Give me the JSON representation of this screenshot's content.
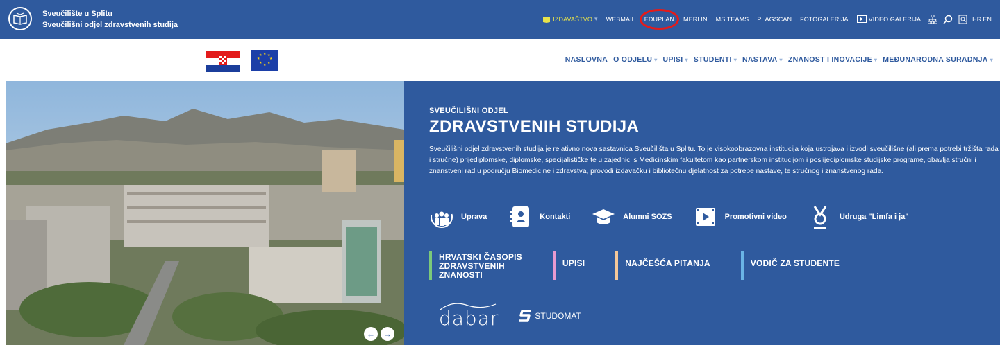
{
  "brand": {
    "line1": "Sveučilište u Splitu",
    "line2": "Sveučilišni odjel zdravstvenih studija"
  },
  "topnav": [
    {
      "label": "IZDAVAŠTVO",
      "caret": "▾"
    },
    {
      "label": "WEBMAIL"
    },
    {
      "label": "EDUPLAN"
    },
    {
      "label": "MERLIN"
    },
    {
      "label": "MS TEAMS"
    },
    {
      "label": "PLAGSCAN"
    },
    {
      "label": "FOTOGALERIJA"
    },
    {
      "label": "VIDEO GALERIJA"
    }
  ],
  "languages": {
    "hr": "HR",
    "en": "EN"
  },
  "mainnav": [
    {
      "label": "NASLOVNA"
    },
    {
      "label": "O ODJELU"
    },
    {
      "label": "UPISI"
    },
    {
      "label": "STUDENTI"
    },
    {
      "label": "NASTAVA"
    },
    {
      "label": "ZNANOST I INOVACIJE"
    },
    {
      "label": "MEĐUNARODNA SURADNJA"
    }
  ],
  "hero": {
    "kicker": "SVEUČILIŠNI ODJEL",
    "title": "ZDRAVSTVENIH STUDIJA",
    "description": "Sveučilišni odjel zdravstvenih studija je relativno nova sastavnica Sveučilišta u Splitu. To je visokoobrazovna institucija koja ustrojava i izvodi sveučilišne (ali prema potrebi tržišta rada i stručne) prijediplomske, diplomske, specijalističke te u zajednici s Medicinskim fakultetom kao partnerskom institucijom i poslijediplomske studijske programe, obavlja stručni i znanstveni rad u području Biomedicine i zdravstva, provodi izdavačku i bibliotečnu djelatnost za potrebe nastave, te stručnog i znanstvenog rada."
  },
  "quick_links": [
    {
      "label": "Uprava",
      "icon": "people-icon"
    },
    {
      "label": "Kontakti",
      "icon": "contacts-icon"
    },
    {
      "label": "Alumni SOZS",
      "icon": "graduation-cap-icon"
    },
    {
      "label": "Promotivni video",
      "icon": "film-icon"
    },
    {
      "label": "Udruga \"Limfa i ja\"",
      "icon": "ribbon-icon"
    }
  ],
  "categories": [
    {
      "lines": [
        "HRVATSKI ČASOPIS",
        "ZDRAVSTVENIH",
        "ZNANOSTI"
      ],
      "color": "#7cc97a"
    },
    {
      "lines": [
        "UPISI"
      ],
      "color": "#e89ad0"
    },
    {
      "lines": [
        "NAJČEŠĆA PITANJA"
      ],
      "color": "#f4c79a"
    },
    {
      "lines": [
        "VODIČ ZA STUDENTE"
      ],
      "color": "#6ab4e6"
    }
  ],
  "partners": {
    "dabar": "dabar",
    "studomat": "STUDOMAT"
  },
  "colors": {
    "primary": "#2f5a9e",
    "active": "#e8e34a",
    "highlight": "#e31b1b"
  }
}
